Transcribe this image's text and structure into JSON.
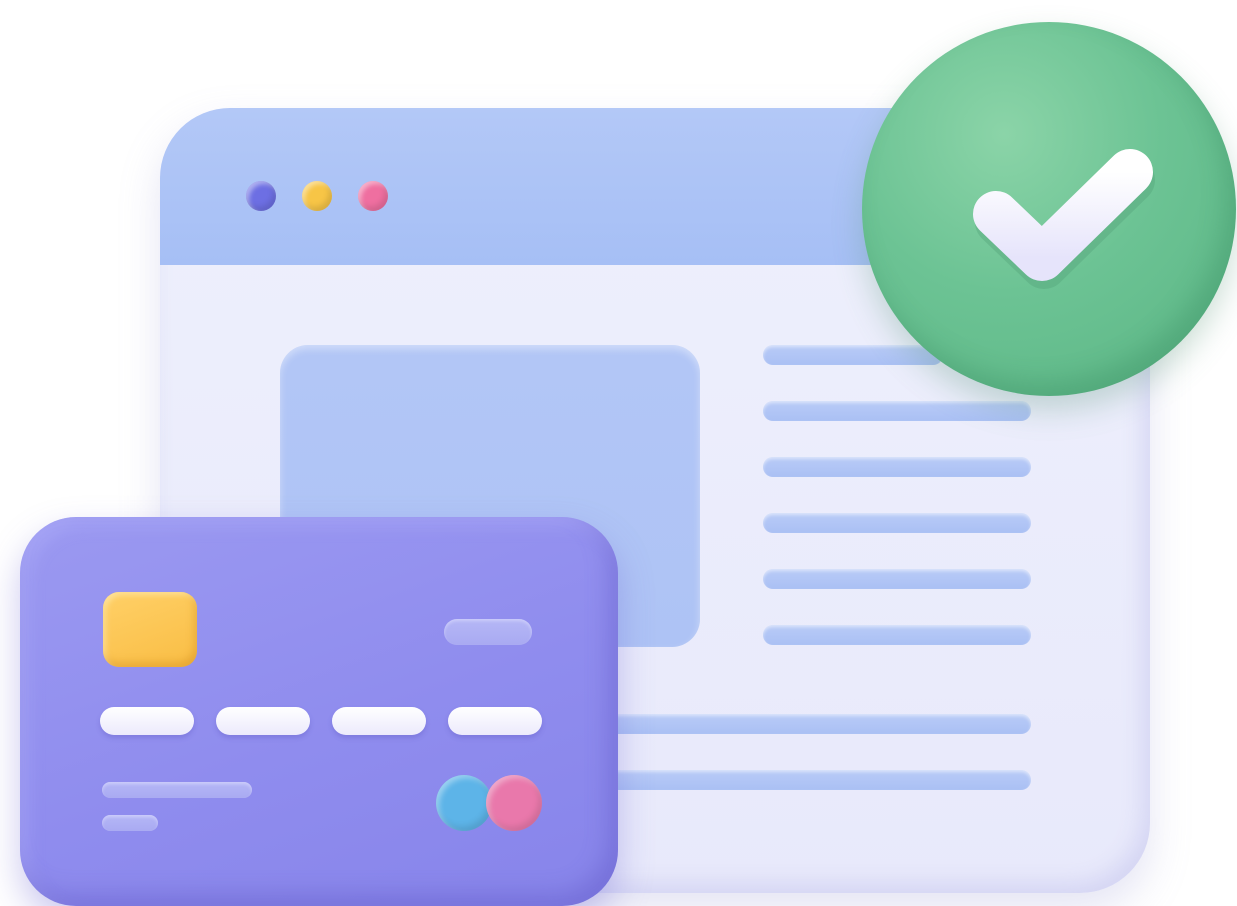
{
  "window": {
    "traffic_lights": [
      {
        "name": "dot-purple",
        "color": "#6d6fe3"
      },
      {
        "name": "dot-yellow",
        "color": "#f7c546"
      },
      {
        "name": "dot-pink",
        "color": "#ef6fa0"
      }
    ],
    "titlebar_color": "#a9c1f5",
    "body_color": "#ecedfb",
    "text_line_color": "#b0c4f5"
  },
  "badge": {
    "icon": "checkmark-icon",
    "color": "#6cc394"
  },
  "card": {
    "color": "#918eee",
    "chip_color": "#fbc24c",
    "logo_colors": [
      "#5db4e8",
      "#ef78a8"
    ]
  }
}
